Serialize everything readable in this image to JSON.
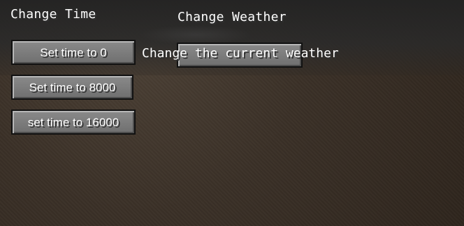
{
  "sections": {
    "time_title": "Change Time",
    "weather_title": "Change Weather"
  },
  "buttons": {
    "time_0": "Set time to 0",
    "time_8000": "Set time to 8000",
    "time_16000": "set time to 16000",
    "weather_label": "Change the current weather"
  },
  "theme": {
    "button_fill": "#7b7b7b",
    "button_border": "#111111",
    "text": "#ffffff",
    "background": "#3a3027"
  }
}
